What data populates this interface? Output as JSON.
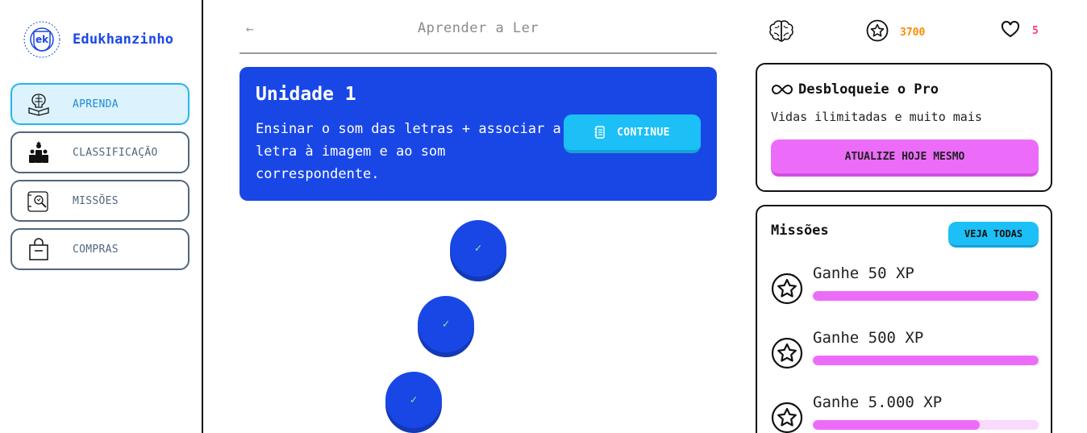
{
  "brand": {
    "name": "Edukhanzinho",
    "logo_text": "ek",
    "logo_ring_text": "Edukhan Acadêmico Escolar Reforço"
  },
  "sidebar": {
    "items": [
      {
        "label": "APRENDA",
        "icon": "brain-book-icon",
        "active": true
      },
      {
        "label": "CLASSIFICAÇÃO",
        "icon": "leaderboard-podium-icon",
        "active": false
      },
      {
        "label": "MISSÕES",
        "icon": "map-magnifier-icon",
        "active": false
      },
      {
        "label": "COMPRAS",
        "icon": "shopping-bag-icon",
        "active": false
      }
    ]
  },
  "header": {
    "back_icon": "arrow-left-icon",
    "title": "Aprender a Ler"
  },
  "unit": {
    "title": "Unidade 1",
    "description": "Ensinar o som das letras + associar a letra à imagem e ao som correspondente.",
    "continue_label": "CONTINUE",
    "continue_icon": "notebook-icon"
  },
  "lessons": [
    {
      "status": "completed",
      "mark": "✓"
    },
    {
      "status": "completed",
      "mark": "✓"
    },
    {
      "status": "completed",
      "mark": "✓"
    }
  ],
  "stats": {
    "course_icon": "brain-icon",
    "xp_icon": "star-icon",
    "xp": "3700",
    "lives_icon": "heart-icon",
    "lives": "5"
  },
  "pro": {
    "icon": "infinity-icon",
    "title": "Desbloqueie o Pro",
    "subtitle": "Vidas ilimitadas e muito mais",
    "button_label": "ATUALIZE HOJE MESMO"
  },
  "missions": {
    "title": "Missões",
    "see_all_label": "VEJA TODAS",
    "items": [
      {
        "label": "Ganhe 50 XP",
        "progress": 1.0
      },
      {
        "label": "Ganhe 500 XP",
        "progress": 1.0
      },
      {
        "label": "Ganhe 5.000 XP",
        "progress": 0.74
      }
    ]
  },
  "colors": {
    "primary_blue": "#1947e6",
    "sky": "#1cc0f7",
    "pink": "#ec6cf9",
    "xp_orange": "#ff8a00",
    "heart_pink": "#ff3a7a",
    "check_green": "#8ff08a",
    "nav_text": "#51667e"
  }
}
